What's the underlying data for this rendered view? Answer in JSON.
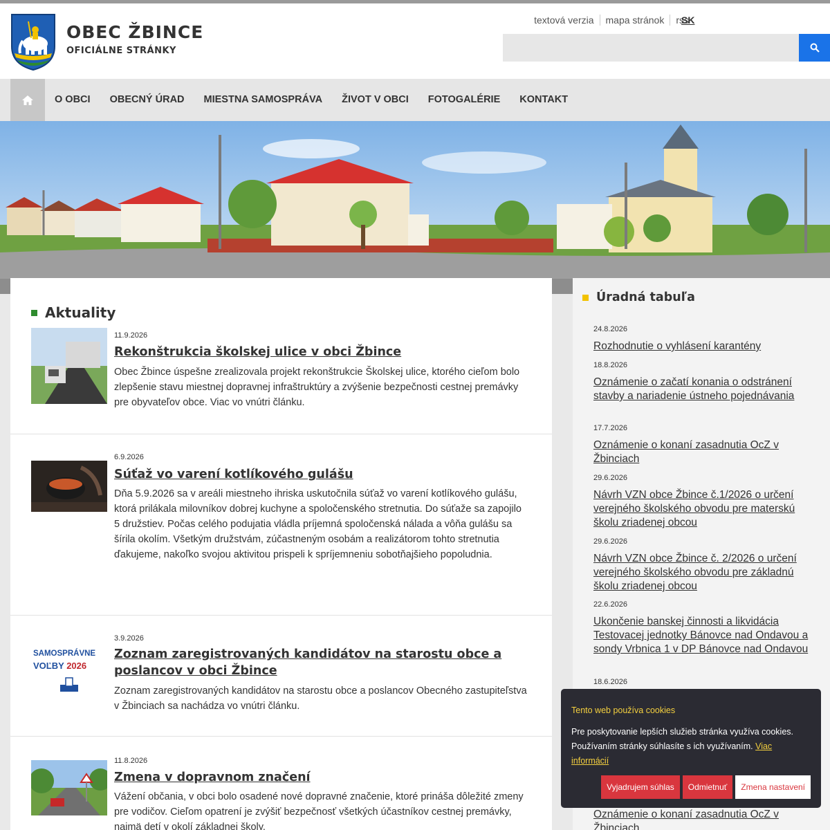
{
  "header": {
    "title": "OBEC ŽBINCE",
    "subtitle": "OFICIÁLNE STRÁNKY",
    "links": [
      "textová verzia",
      "mapa stránok",
      "rss"
    ],
    "lang": "SK",
    "search_placeholder": ""
  },
  "nav": {
    "items": [
      "O OBCI",
      "OBECNÝ ÚRAD",
      "MIESTNA SAMOSPRÁVA",
      "ŽIVOT V OBCI",
      "FOTOGALÉRIE",
      "KONTAKT"
    ]
  },
  "main": {
    "title": "Aktuality",
    "articles": [
      {
        "date": "11.9.2026",
        "title": "Rekonštrukcia školskej ulice v obci Žbince",
        "text": "Obec Žbince úspešne zrealizovala projekt rekonštrukcie Školskej ulice, ktorého cieľom bolo zlepšenie stavu miestnej dopravnej infraštruktúry a zvýšenie bezpečnosti cestnej premávky pre obyvateľov obce. Viac vo vnútri článku."
      },
      {
        "date": "6.9.2026",
        "title": "Súťaž vo varení kotlíkového gulášu",
        "text": "Dňa 5.9.2026 sa v areáli miestneho ihriska uskutočnila súťaž vo varení kotlíkového gulášu, ktorá prilákala milovníkov dobrej kuchyne a spoločenského stretnutia. Do súťaže sa zapojilo 5 družstiev. Počas celého podujatia vládla príjemná spoločenská nálada a vôňa gulášu sa šírila okolím. Všetkým družstvám, zúčastneným osobám a realizátorom tohto stretnutia ďakujeme, nakoľko svojou aktivitou prispeli k spríjemneniu sobotňajšieho popoludnia."
      },
      {
        "date": "3.9.2026",
        "title": "Zoznam zaregistrovaných kandidátov na starostu obce a poslancov v obci Žbince",
        "text": "Zoznam zaregistrovaných kandidátov na starostu obce a poslancov Obecného zastupiteľstva v Žbinciach sa nachádza vo vnútri článku.",
        "thumb_line1": "SAMOSPRÁVNE",
        "thumb_line2a": "VOĽBY",
        "thumb_line2b": "2026"
      },
      {
        "date": "11.8.2026",
        "title": "Zmena v dopravnom značení",
        "text": "Vážení občania, v obci bolo osadené nové dopravné značenie, ktoré prináša dôležité zmeny pre vodičov. Cieľom opatrení je zvýšiť bezpečnosť všetkých účastníkov cestnej premávky, najmä detí v okolí základnej školy."
      }
    ]
  },
  "side": {
    "title": "Úradná tabuľa",
    "notices": [
      {
        "date": "24.8.2026",
        "title": "Rozhodnutie o vyhlásení karantény"
      },
      {
        "date": "18.8.2026",
        "title": "Oznámenie o začatí konania o odstránení stavby a nariadenie ústneho pojednávania"
      },
      {
        "date": "17.7.2026",
        "title": "Oznámenie o konaní zasadnutia OcZ v Žbinciach"
      },
      {
        "date": "29.6.2026",
        "title": "Návrh VZN obce Žbince č.1/2026 o určení verejného školského obvodu pre materskú školu zriadenej obcou"
      },
      {
        "date": "29.6.2026",
        "title": "Návrh VZN obce Žbince č. 2/2026 o určení verejného školského obvodu pre základnú školu zriadenej obcou"
      },
      {
        "date": "22.6.2026",
        "title": "Ukončenie banskej činnosti a likvidácia Testovacej jednotky Bánovce nad Ondavou a sondy Vrbnica 1 v DP Bánovce nad Ondavou"
      },
      {
        "date": "18.6.2026",
        "title": ""
      },
      {
        "date": "",
        "title": "Oznámenie o konaní zasadnutia OcZ v Žbinciach"
      }
    ]
  },
  "cookie": {
    "title": "Tento web používa cookies",
    "text": "Pre poskytovanie lepších služieb stránka využíva cookies. Používaním stránky súhlasíte s ich využívaním.",
    "link": "Viac informácií",
    "accept": "Vyjadrujem súhlas",
    "reject": "Odmietnuť",
    "settings": "Zmena nastavení"
  },
  "colors": {
    "accent_green": "#2e8b2e",
    "accent_yellow": "#f2c200",
    "search_blue": "#1a73e8",
    "cookie_red": "#d9363e"
  }
}
